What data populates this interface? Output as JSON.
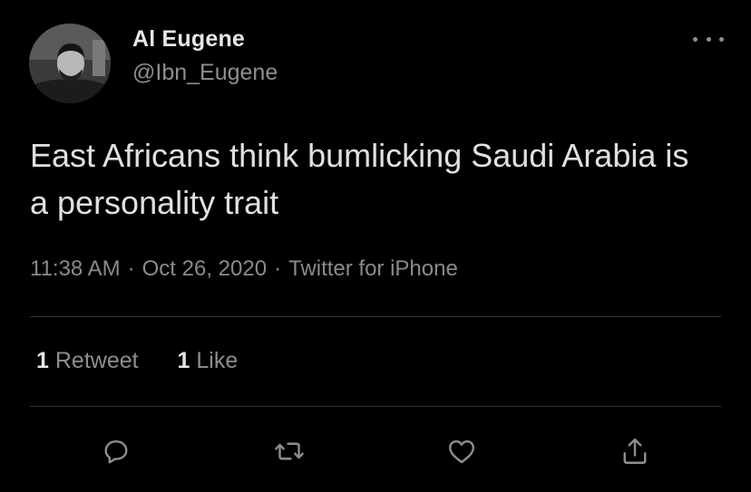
{
  "author": {
    "display_name": "Al Eugene",
    "handle": "@Ibn_Eugene"
  },
  "tweet": {
    "text": "East Africans think bumlicking Saudi Arabia is a personality trait",
    "time": "11:38 AM",
    "separator": "·",
    "date": "Oct 26, 2020",
    "source": "Twitter for iPhone"
  },
  "stats": {
    "retweets_count": "1",
    "retweets_label": "Retweet",
    "likes_count": "1",
    "likes_label": "Like"
  },
  "icons": {
    "more": "more-horizontal-icon",
    "reply": "reply-icon",
    "retweet": "retweet-icon",
    "like": "heart-icon",
    "share": "share-icon"
  },
  "colors": {
    "background": "#000000",
    "primary_text": "#e0e0e0",
    "secondary_text": "#8e8e8e",
    "divider": "#333333"
  }
}
